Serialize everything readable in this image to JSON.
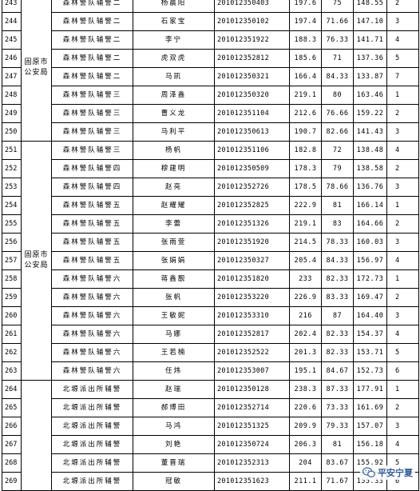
{
  "table": {
    "group_a_unit": "固原市公安局",
    "group_b_unit": "固原市公安局",
    "rows": [
      {
        "no": "243",
        "position": "森林警队辅警二",
        "name": "杨晨阳",
        "id": "201012350403",
        "written": "197.6",
        "interview": "75",
        "total": "148.55",
        "rank": "2"
      },
      {
        "no": "244",
        "position": "森林警队辅警二",
        "name": "石家宝",
        "id": "201012350102",
        "written": "197.4",
        "interview": "71.66",
        "total": "147.10",
        "rank": "3"
      },
      {
        "no": "245",
        "position": "森林警队辅警二",
        "name": "李宁",
        "id": "201012351922",
        "written": "188.3",
        "interview": "76.33",
        "total": "141.71",
        "rank": "4"
      },
      {
        "no": "246",
        "position": "森林警队辅警二",
        "name": "虎双虎",
        "id": "201012352812",
        "written": "185.6",
        "interview": "71",
        "total": "137.36",
        "rank": "5"
      },
      {
        "no": "247",
        "position": "森林警队辅警二",
        "name": "马凯",
        "id": "201012350321",
        "written": "166.4",
        "interview": "84.33",
        "total": "133.87",
        "rank": "7"
      },
      {
        "no": "248",
        "position": "森林警队辅警三",
        "name": "周泽鑫",
        "id": "201012350320",
        "written": "219.1",
        "interview": "80",
        "total": "163.46",
        "rank": "1"
      },
      {
        "no": "249",
        "position": "森林警队辅警三",
        "name": "曹义龙",
        "id": "201012351104",
        "written": "212.6",
        "interview": "76.66",
        "total": "159.22",
        "rank": "2"
      },
      {
        "no": "250",
        "position": "森林警队辅警三",
        "name": "马利平",
        "id": "201012350613",
        "written": "190.7",
        "interview": "82.66",
        "total": "141.43",
        "rank": "3"
      },
      {
        "no": "251",
        "position": "森林警队辅警三",
        "name": "杨帆",
        "id": "201012351106",
        "written": "182.8",
        "interview": "72",
        "total": "138.48",
        "rank": "4"
      },
      {
        "no": "252",
        "position": "森林警队辅警四",
        "name": "穆建明",
        "id": "201012350509",
        "written": "178.3",
        "interview": "79",
        "total": "138.58",
        "rank": "2"
      },
      {
        "no": "253",
        "position": "森林警队辅警四",
        "name": "赵亮",
        "id": "201012352726",
        "written": "178.5",
        "interview": "78.66",
        "total": "136.76",
        "rank": "3"
      },
      {
        "no": "254",
        "position": "森林警队辅警五",
        "name": "赵耀耀",
        "id": "201012352825",
        "written": "222.9",
        "interview": "81",
        "total": "166.14",
        "rank": "1"
      },
      {
        "no": "255",
        "position": "森林警队辅警五",
        "name": "李蕾",
        "id": "201012351326",
        "written": "219.1",
        "interview": "83",
        "total": "164.66",
        "rank": "2"
      },
      {
        "no": "256",
        "position": "森林警队辅警五",
        "name": "张雨萱",
        "id": "201012351920",
        "written": "214.5",
        "interview": "78.33",
        "total": "160.03",
        "rank": "3"
      },
      {
        "no": "257",
        "position": "森林警队辅警五",
        "name": "张娟娟",
        "id": "201012350327",
        "written": "205.4",
        "interview": "84.33",
        "total": "156.97",
        "rank": "4"
      },
      {
        "no": "258",
        "position": "森林警队辅警六",
        "name": "蒋鑫靓",
        "id": "201012351820",
        "written": "233",
        "interview": "82.33",
        "total": "172.73",
        "rank": "1"
      },
      {
        "no": "259",
        "position": "森林警队辅警六",
        "name": "张帆",
        "id": "201012353220",
        "written": "226.9",
        "interview": "83.33",
        "total": "169.47",
        "rank": "2"
      },
      {
        "no": "260",
        "position": "森林警队辅警六",
        "name": "王敏妮",
        "id": "201012353310",
        "written": "216",
        "interview": "87",
        "total": "164.40",
        "rank": "3"
      },
      {
        "no": "261",
        "position": "森林警队辅警六",
        "name": "马娜",
        "id": "201012352817",
        "written": "202.4",
        "interview": "82.33",
        "total": "154.37",
        "rank": "4"
      },
      {
        "no": "262",
        "position": "森林警队辅警六",
        "name": "王若楠",
        "id": "201012352522",
        "written": "201.3",
        "interview": "82.33",
        "total": "153.71",
        "rank": "5"
      },
      {
        "no": "263",
        "position": "森林警队辅警六",
        "name": "任炜",
        "id": "201012353007",
        "written": "195.1",
        "interview": "84.67",
        "total": "152.73",
        "rank": "6"
      },
      {
        "no": "264",
        "position": "北塬派出所辅警",
        "name": "赵瑞",
        "id": "201012350128",
        "written": "238.3",
        "interview": "87.33",
        "total": "177.91",
        "rank": "1"
      },
      {
        "no": "265",
        "position": "北塬派出所辅警",
        "name": "郝博田",
        "id": "201012352714",
        "written": "220.6",
        "interview": "73.33",
        "total": "161.69",
        "rank": "2"
      },
      {
        "no": "266",
        "position": "北塬派出所辅警",
        "name": "马鸿",
        "id": "201012351325",
        "written": "209.9",
        "interview": "79.33",
        "total": "157.07",
        "rank": "3"
      },
      {
        "no": "267",
        "position": "北塬派出所辅警",
        "name": "刘艳",
        "id": "201012350724",
        "written": "206.3",
        "interview": "81",
        "total": "156.18",
        "rank": "4"
      },
      {
        "no": "268",
        "position": "北塬派出所辅警",
        "name": "董晋瑞",
        "id": "201012352313",
        "written": "204",
        "interview": "83.67",
        "total": "155.92",
        "rank": "5"
      },
      {
        "no": "269",
        "position": "北塬派出所辅警",
        "name": "冠敏",
        "id": "201012351623",
        "written": "211.1",
        "interview": "71.67",
        "total": "155.33",
        "rank": "6"
      }
    ]
  },
  "watermark": {
    "text": "平安宁夏",
    "icon": "wechat-logo-icon",
    "color": "#2f5d9a"
  }
}
